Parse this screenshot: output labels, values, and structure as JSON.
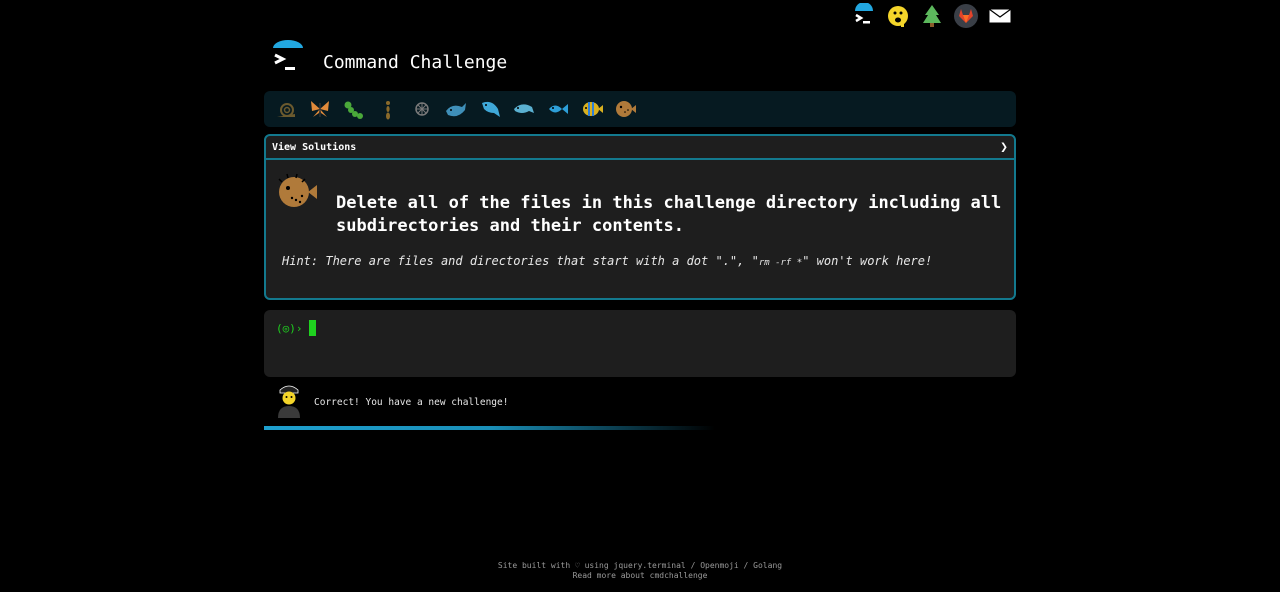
{
  "top_icons": [
    {
      "name": "terminal-icon"
    },
    {
      "name": "face-icon"
    },
    {
      "name": "tree-icon"
    },
    {
      "name": "gitlab-icon"
    },
    {
      "name": "mail-icon"
    }
  ],
  "header": {
    "title": "Command Challenge"
  },
  "levels": [
    {
      "name": "snail-icon",
      "color": "#6b5a2e"
    },
    {
      "name": "butterfly-icon",
      "color": "#e08a3a"
    },
    {
      "name": "caterpillar-icon",
      "color": "#4aa83a"
    },
    {
      "name": "ant-icon",
      "color": "#8a6a2a"
    },
    {
      "name": "shell-icon",
      "color": "#7a7a7a"
    },
    {
      "name": "whale-icon",
      "color": "#3f8fb8"
    },
    {
      "name": "dolphin-icon",
      "color": "#3fa8d8"
    },
    {
      "name": "dolphin2-icon",
      "color": "#5ab0d0"
    },
    {
      "name": "fish-icon",
      "color": "#2d9fd8"
    },
    {
      "name": "tropical-fish-icon",
      "color": "#d8b020"
    },
    {
      "name": "blowfish-icon",
      "color": "#b07a3a"
    }
  ],
  "card": {
    "view_solutions": "View Solutions",
    "chevron": "❯",
    "challenge": "Delete all of the files in this challenge directory including all subdirectories and their contents.",
    "hint_prefix": "Hint: There are files and directories that start with a dot \".\", \"",
    "hint_code": "rm -rf *",
    "hint_suffix": "\" won't work here!"
  },
  "terminal": {
    "prompt": "(◎)›"
  },
  "message": {
    "text": "Correct! You have a new challenge!",
    "progress_percent": 60
  },
  "footer": {
    "line1": "Site built with ♡ using jquery.terminal / Openmoji / Golang",
    "line2": "Read more about cmdchallenge"
  }
}
